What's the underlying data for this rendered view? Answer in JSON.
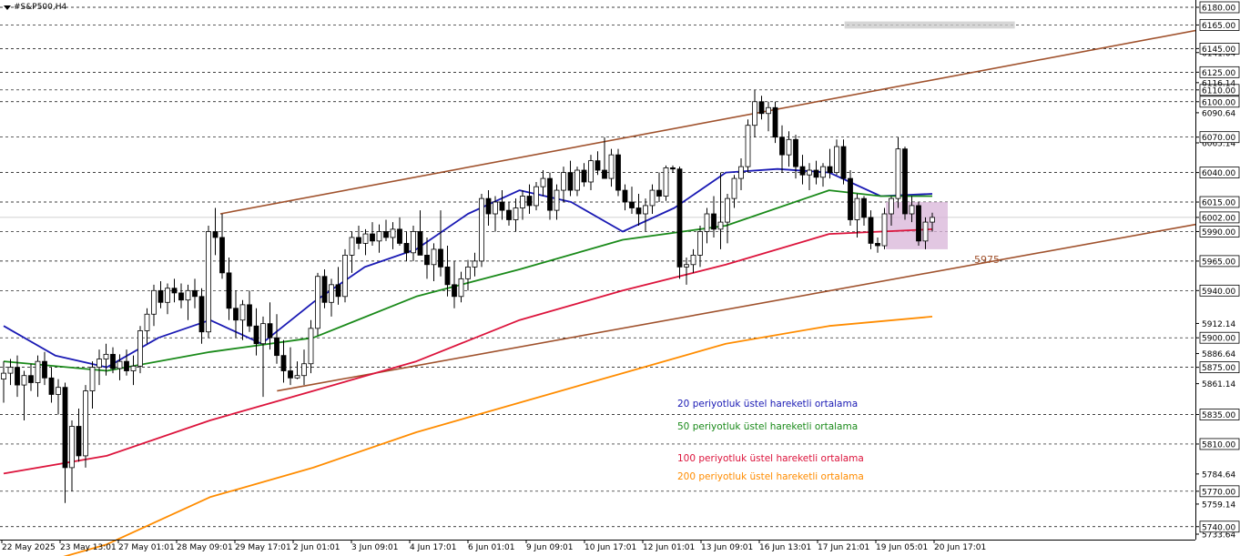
{
  "symbol": "#S&P500,H4",
  "colors": {
    "ema20": "#1a1ab4",
    "ema50": "#1a8a1a",
    "ema100": "#dc143c",
    "ema200": "#ff8c00",
    "channel": "#a0522d",
    "candle": "#000000",
    "zone": "#d8b4d8",
    "target_zone": "#c8c8c8",
    "grid": "#000000"
  },
  "chart_data": {
    "type": "candlestick",
    "title": "",
    "xlabel": "",
    "ylabel": "",
    "ylim": [
      5733.64,
      6180
    ],
    "x_ticks": [
      "22 May 2025",
      "23 May 13:01",
      "27 May 01:01",
      "28 May 09:01",
      "29 May 17:01",
      "2 Jun 01:01",
      "3 Jun 09:01",
      "4 Jun 17:01",
      "6 Jun 01:01",
      "9 Jun 09:01",
      "10 Jun 17:01",
      "12 Jun 01:01",
      "13 Jun 09:01",
      "16 Jun 13:01",
      "17 Jun 21:01",
      "19 Jun 05:01",
      "20 Jun 17:01"
    ],
    "y_ticks": [
      "5733.64",
      "5740.00",
      "5759.14",
      "5770.00",
      "5784.64",
      "5810.00",
      "5835.00",
      "5861.14",
      "5875.00",
      "5886.64",
      "5900.00",
      "5912.14",
      "5940.00",
      "5965.00",
      "5990.00",
      "6002.00",
      "6015.00",
      "6040.00",
      "6065.14",
      "6070.00",
      "6090.64",
      "6100.00",
      "6110.00",
      "6116.14",
      "6125.00",
      "6141.64",
      "6145.00",
      "6165.00",
      "6180.00"
    ],
    "horizontal_levels": [
      6180,
      6165,
      6145,
      6125,
      6110,
      6100,
      6070,
      6040,
      6015,
      5990,
      5965,
      5940,
      5900,
      5875,
      5835,
      5810,
      5770,
      5740
    ],
    "current_price": 6002.0,
    "annotation": "5975",
    "legend": [
      {
        "label": "20 periyotluk üstel hareketli ortalama",
        "color": "#1a1ab4"
      },
      {
        "label": "50 periyotluk üstel hareketli ortalama",
        "color": "#1a8a1a"
      },
      {
        "label": "100 periyotluk üstel hareketli ortalama",
        "color": "#dc143c"
      },
      {
        "label": "200 periyotluk üstel hareketli ortalama",
        "color": "#ff8c00"
      }
    ],
    "candles": [
      [
        5865,
        5880,
        5845,
        5870
      ],
      [
        5870,
        5882,
        5860,
        5875
      ],
      [
        5875,
        5885,
        5850,
        5860
      ],
      [
        5860,
        5872,
        5830,
        5868
      ],
      [
        5868,
        5878,
        5855,
        5862
      ],
      [
        5862,
        5885,
        5850,
        5880
      ],
      [
        5880,
        5888,
        5860,
        5866
      ],
      [
        5866,
        5875,
        5845,
        5852
      ],
      [
        5852,
        5865,
        5835,
        5858
      ],
      [
        5858,
        5862,
        5760,
        5790
      ],
      [
        5790,
        5830,
        5770,
        5825
      ],
      [
        5825,
        5840,
        5795,
        5800
      ],
      [
        5800,
        5860,
        5790,
        5855
      ],
      [
        5855,
        5880,
        5840,
        5875
      ],
      [
        5875,
        5890,
        5860,
        5882
      ],
      [
        5882,
        5895,
        5868,
        5886
      ],
      [
        5886,
        5892,
        5870,
        5874
      ],
      [
        5874,
        5886,
        5864,
        5880
      ],
      [
        5880,
        5890,
        5868,
        5872
      ],
      [
        5872,
        5885,
        5860,
        5876
      ],
      [
        5876,
        5910,
        5870,
        5906
      ],
      [
        5906,
        5925,
        5895,
        5920
      ],
      [
        5920,
        5945,
        5910,
        5940
      ],
      [
        5940,
        5948,
        5925,
        5930
      ],
      [
        5930,
        5946,
        5920,
        5942
      ],
      [
        5942,
        5950,
        5930,
        5938
      ],
      [
        5938,
        5946,
        5925,
        5932
      ],
      [
        5932,
        5945,
        5915,
        5940
      ],
      [
        5940,
        5950,
        5925,
        5935
      ],
      [
        5935,
        5942,
        5895,
        5905
      ],
      [
        5905,
        5995,
        5900,
        5990
      ],
      [
        5990,
        6010,
        5970,
        5985
      ],
      [
        5985,
        6005,
        5950,
        5955
      ],
      [
        5955,
        5968,
        5915,
        5925
      ],
      [
        5925,
        5940,
        5900,
        5915
      ],
      [
        5915,
        5932,
        5898,
        5928
      ],
      [
        5928,
        5940,
        5905,
        5910
      ],
      [
        5910,
        5925,
        5885,
        5895
      ],
      [
        5895,
        5918,
        5850,
        5912
      ],
      [
        5912,
        5930,
        5890,
        5900
      ],
      [
        5900,
        5920,
        5878,
        5885
      ],
      [
        5885,
        5898,
        5862,
        5872
      ],
      [
        5872,
        5892,
        5860,
        5866
      ],
      [
        5866,
        5880,
        5865,
        5868
      ],
      [
        5868,
        5890,
        5860,
        5878
      ],
      [
        5878,
        5915,
        5870,
        5908
      ],
      [
        5908,
        5955,
        5902,
        5952
      ],
      [
        5952,
        5958,
        5925,
        5930
      ],
      [
        5930,
        5950,
        5918,
        5945
      ],
      [
        5945,
        5960,
        5928,
        5935
      ],
      [
        5935,
        5975,
        5930,
        5970
      ],
      [
        5970,
        5990,
        5955,
        5985
      ],
      [
        5985,
        5995,
        5975,
        5980
      ],
      [
        5980,
        5992,
        5970,
        5988
      ],
      [
        5988,
        5998,
        5978,
        5982
      ],
      [
        5982,
        5996,
        5972,
        5990
      ],
      [
        5990,
        6000,
        5982,
        5985
      ],
      [
        5985,
        5998,
        5975,
        5992
      ],
      [
        5992,
        6002,
        5978,
        5980
      ],
      [
        5980,
        5990,
        5965,
        5972
      ],
      [
        5972,
        5995,
        5965,
        5990
      ],
      [
        5990,
        6008,
        5980,
        5970
      ],
      [
        5970,
        5985,
        5950,
        5962
      ],
      [
        5962,
        5980,
        5948,
        5975
      ],
      [
        5975,
        6008,
        5952,
        5960
      ],
      [
        5960,
        5978,
        5935,
        5945
      ],
      [
        5945,
        5965,
        5925,
        5935
      ],
      [
        5935,
        5956,
        5930,
        5950
      ],
      [
        5950,
        5966,
        5940,
        5960
      ],
      [
        5960,
        5972,
        5952,
        5965
      ],
      [
        5965,
        6022,
        5960,
        6018
      ],
      [
        6018,
        6025,
        5995,
        6005
      ],
      [
        6005,
        6020,
        5990,
        6015
      ],
      [
        6015,
        6025,
        6000,
        6008
      ],
      [
        6008,
        6015,
        5995,
        6000
      ],
      [
        6000,
        6018,
        5990,
        6010
      ],
      [
        6010,
        6025,
        6000,
        6020
      ],
      [
        6020,
        6030,
        6005,
        6012
      ],
      [
        6012,
        6032,
        6008,
        6028
      ],
      [
        6028,
        6042,
        6020,
        6035
      ],
      [
        6035,
        6040,
        6000,
        6008
      ],
      [
        6008,
        6030,
        6000,
        6025
      ],
      [
        6025,
        6045,
        6015,
        6040
      ],
      [
        6040,
        6050,
        6020,
        6025
      ],
      [
        6025,
        6045,
        6020,
        6042
      ],
      [
        6042,
        6048,
        6028,
        6032
      ],
      [
        6032,
        6055,
        6025,
        6050
      ],
      [
        6050,
        6058,
        6038,
        6042
      ],
      [
        6042,
        6070,
        6035,
        6035
      ],
      [
        6035,
        6060,
        6028,
        6055
      ],
      [
        6055,
        6060,
        6020,
        6025
      ],
      [
        6025,
        6030,
        6008,
        6015
      ],
      [
        6015,
        6028,
        6005,
        6010
      ],
      [
        6010,
        6022,
        5995,
        6005
      ],
      [
        6005,
        6018,
        5990,
        6012
      ],
      [
        6012,
        6030,
        6005,
        6025
      ],
      [
        6025,
        6040,
        6015,
        6020
      ],
      [
        6020,
        6046,
        6016,
        6044
      ],
      [
        6044,
        6046,
        6040,
        6043
      ],
      [
        6043,
        6045,
        5950,
        5960
      ],
      [
        5960,
        5968,
        5945,
        5962
      ],
      [
        5962,
        5975,
        5955,
        5970
      ],
      [
        5970,
        5995,
        5960,
        5990
      ],
      [
        5990,
        6010,
        5980,
        6005
      ],
      [
        6005,
        6020,
        5985,
        5992
      ],
      [
        5992,
        6040,
        5975,
        5998
      ],
      [
        5998,
        6022,
        5980,
        6018
      ],
      [
        6018,
        6038,
        6010,
        6035
      ],
      [
        6035,
        6052,
        6025,
        6045
      ],
      [
        6045,
        6085,
        6040,
        6080
      ],
      [
        6080,
        6110,
        6070,
        6100
      ],
      [
        6100,
        6105,
        6085,
        6090
      ],
      [
        6090,
        6100,
        6075,
        6095
      ],
      [
        6095,
        6100,
        6065,
        6070
      ],
      [
        6070,
        6080,
        6040,
        6055
      ],
      [
        6055,
        6075,
        6045,
        6068
      ],
      [
        6068,
        6072,
        6035,
        6045
      ],
      [
        6045,
        6055,
        6030,
        6038
      ],
      [
        6038,
        6048,
        6025,
        6042
      ],
      [
        6042,
        6050,
        6030,
        6036
      ],
      [
        6036,
        6048,
        6028,
        6045
      ],
      [
        6045,
        6060,
        6035,
        6040
      ],
      [
        6040,
        6068,
        6038,
        6062
      ],
      [
        6062,
        6068,
        6030,
        6035
      ],
      [
        6035,
        6042,
        5995,
        6000
      ],
      [
        6000,
        6022,
        5985,
        6018
      ],
      [
        6018,
        6020,
        5995,
        6002
      ],
      [
        6002,
        6008,
        5975,
        5980
      ],
      [
        5980,
        5985,
        5972,
        5978
      ],
      [
        5978,
        6010,
        5975,
        6005
      ],
      [
        6005,
        6020,
        5995,
        6018
      ],
      [
        6018,
        6070,
        6010,
        6060
      ],
      [
        6060,
        6062,
        6000,
        6005
      ],
      [
        6005,
        6020,
        5998,
        6012
      ],
      [
        6012,
        6015,
        5978,
        5982
      ],
      [
        5982,
        6002,
        5975,
        5998
      ],
      [
        5998,
        6006,
        5990,
        6002
      ]
    ],
    "series": [
      {
        "name": "20 periyotluk üstel hareketli ortalama",
        "values": [
          [
            0,
            5910
          ],
          [
            10,
            5885
          ],
          [
            20,
            5875
          ],
          [
            30,
            5900
          ],
          [
            40,
            5915
          ],
          [
            50,
            5895
          ],
          [
            60,
            5930
          ],
          [
            70,
            5960
          ],
          [
            80,
            5975
          ],
          [
            90,
            6005
          ],
          [
            100,
            6025
          ],
          [
            110,
            6015
          ],
          [
            120,
            5990
          ],
          [
            130,
            6010
          ],
          [
            140,
            6040
          ],
          [
            150,
            6043
          ],
          [
            160,
            6040
          ],
          [
            170,
            6020
          ],
          [
            180,
            6022
          ]
        ]
      },
      {
        "name": "50 periyotluk üstel hareketli ortalama",
        "values": [
          [
            0,
            5880
          ],
          [
            20,
            5872
          ],
          [
            40,
            5888
          ],
          [
            60,
            5900
          ],
          [
            80,
            5935
          ],
          [
            100,
            5958
          ],
          [
            120,
            5983
          ],
          [
            140,
            5995
          ],
          [
            160,
            6025
          ],
          [
            170,
            6020
          ],
          [
            180,
            6020
          ]
        ]
      },
      {
        "name": "100 periyotluk üstel hareketli ortalama",
        "values": [
          [
            0,
            5785
          ],
          [
            20,
            5800
          ],
          [
            40,
            5830
          ],
          [
            60,
            5855
          ],
          [
            80,
            5880
          ],
          [
            100,
            5915
          ],
          [
            120,
            5940
          ],
          [
            140,
            5962
          ],
          [
            160,
            5988
          ],
          [
            180,
            5992
          ]
        ]
      },
      {
        "name": "200 periyotluk üstel hareketli ortalama",
        "values": [
          [
            0,
            5700
          ],
          [
            20,
            5725
          ],
          [
            40,
            5765
          ],
          [
            60,
            5790
          ],
          [
            80,
            5820
          ],
          [
            100,
            5845
          ],
          [
            120,
            5870
          ],
          [
            140,
            5895
          ],
          [
            160,
            5910
          ],
          [
            180,
            5918
          ]
        ]
      }
    ],
    "channel_lines": [
      [
        [
          42,
          6005
        ],
        [
          255,
          6180
        ]
      ],
      [
        [
          53,
          5855
        ],
        [
          255,
          6015
        ]
      ]
    ],
    "zones": [
      {
        "name": "target",
        "x": [
          163,
          196
        ],
        "y": [
          6162,
          6168
        ]
      },
      {
        "name": "support",
        "x": [
          171,
          183
        ],
        "y": [
          5975,
          6015
        ]
      }
    ]
  }
}
